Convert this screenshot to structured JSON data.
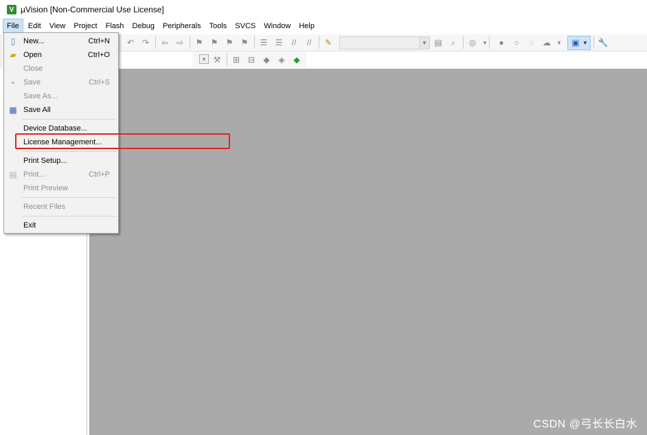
{
  "app": {
    "icon_label": "V",
    "title": "µVision  [Non-Commercial Use License]"
  },
  "menubar": {
    "items": [
      {
        "label": "File",
        "active": true
      },
      {
        "label": "Edit"
      },
      {
        "label": "View"
      },
      {
        "label": "Project"
      },
      {
        "label": "Flash"
      },
      {
        "label": "Debug"
      },
      {
        "label": "Peripherals"
      },
      {
        "label": "Tools"
      },
      {
        "label": "SVCS"
      },
      {
        "label": "Window"
      },
      {
        "label": "Help"
      }
    ]
  },
  "file_menu": {
    "items": [
      {
        "label": "New...",
        "shortcut": "Ctrl+N",
        "icon": "new-file-icon",
        "enabled": true
      },
      {
        "label": "Open",
        "shortcut": "Ctrl+O",
        "icon": "open-folder-icon",
        "enabled": true
      },
      {
        "label": "Close",
        "shortcut": "",
        "icon": "",
        "enabled": false
      },
      {
        "label": "Save",
        "shortcut": "Ctrl+S",
        "icon": "save-icon",
        "enabled": false
      },
      {
        "label": "Save As...",
        "shortcut": "",
        "icon": "",
        "enabled": false
      },
      {
        "label": "Save All",
        "shortcut": "",
        "icon": "save-all-icon",
        "enabled": true
      },
      {
        "label": "Device Database...",
        "shortcut": "",
        "icon": "",
        "enabled": true
      },
      {
        "label": "License Management...",
        "shortcut": "",
        "icon": "",
        "enabled": true,
        "highlighted": true
      },
      {
        "label": "Print Setup...",
        "shortcut": "",
        "icon": "",
        "enabled": true
      },
      {
        "label": "Print...",
        "shortcut": "Ctrl+P",
        "icon": "print-icon",
        "enabled": false
      },
      {
        "label": "Print Preview",
        "shortcut": "",
        "icon": "",
        "enabled": false
      },
      {
        "label": "Recent Files",
        "shortcut": "",
        "icon": "",
        "enabled": false
      },
      {
        "label": "Exit",
        "shortcut": "",
        "icon": "",
        "enabled": true
      }
    ]
  },
  "colors": {
    "highlight_box": "#e2241c",
    "editor_background": "#aaaaaa",
    "menu_active": "#cce4f7"
  },
  "watermark": "CSDN @弓长长白水"
}
